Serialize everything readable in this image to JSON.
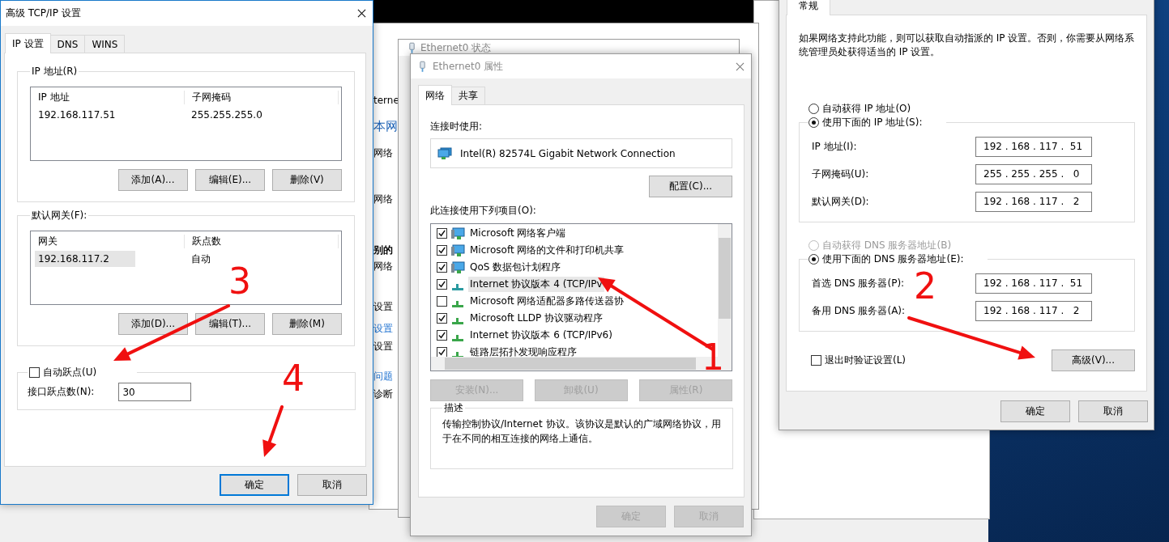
{
  "background_window": {
    "fragments": [
      {
        "text": "terne",
        "kind": "text"
      },
      {
        "text": "本网",
        "kind": "heading"
      },
      {
        "text": "网络",
        "kind": "text"
      },
      {
        "text": "网络",
        "kind": "text"
      },
      {
        "text": "别的",
        "kind": "bold"
      },
      {
        "text": "网络",
        "kind": "text"
      },
      {
        "text": "设置",
        "kind": "text"
      },
      {
        "text": "设置",
        "kind": "link"
      },
      {
        "text": "设置",
        "kind": "text"
      },
      {
        "text": "问题",
        "kind": "link"
      },
      {
        "text": "诊断",
        "kind": "text"
      }
    ]
  },
  "status_window": {
    "title": "Ethernet0 状态"
  },
  "tcpip_dialog": {
    "title": "高级 TCP/IP 设置",
    "tabs": [
      {
        "label": "IP 设置",
        "selected": true
      },
      {
        "label": "DNS",
        "selected": false
      },
      {
        "label": "WINS",
        "selected": false
      }
    ],
    "ip_group": {
      "legend": "IP 地址(R)",
      "columns": [
        "IP 地址",
        "子网掩码"
      ],
      "rows": [
        {
          "cells": [
            "192.168.117.51",
            "255.255.255.0"
          ],
          "selected": false
        }
      ],
      "buttons": [
        "添加(A)...",
        "编辑(E)...",
        "删除(V)"
      ]
    },
    "gateway_group": {
      "legend": "默认网关(F):",
      "columns": [
        "网关",
        "跃点数"
      ],
      "rows": [
        {
          "cells": [
            "192.168.117.2",
            "自动"
          ],
          "selected": true
        }
      ],
      "buttons": [
        "添加(D)...",
        "编辑(T)...",
        "删除(M)"
      ]
    },
    "metric_group": {
      "checkbox": {
        "label": "自动跃点(U)",
        "checked": false
      },
      "label": "接口跃点数(N):",
      "value": "30"
    },
    "buttons": [
      {
        "label": "确定",
        "default": true
      },
      {
        "label": "取消",
        "default": false
      }
    ]
  },
  "properties_dialog": {
    "title": "Ethernet0 属性",
    "tabs": [
      {
        "label": "网络",
        "selected": true
      },
      {
        "label": "共享",
        "selected": false
      }
    ],
    "connect_label": "连接时使用:",
    "adapter": "Intel(R) 82574L Gigabit Network Connection",
    "configure_button": "配置(C)...",
    "items_label": "此连接使用下列项目(O):",
    "items": [
      {
        "label": "Microsoft 网络客户端",
        "checked": true,
        "selected": false,
        "kind": "service"
      },
      {
        "label": "Microsoft 网络的文件和打印机共享",
        "checked": true,
        "selected": false,
        "kind": "service"
      },
      {
        "label": "QoS 数据包计划程序",
        "checked": true,
        "selected": false,
        "kind": "service"
      },
      {
        "label": "Internet 协议版本 4 (TCP/IPv",
        "checked": true,
        "selected": true,
        "kind": "protocol"
      },
      {
        "label": "Microsoft 网络适配器多路传送器协",
        "checked": false,
        "selected": false,
        "kind": "protocol"
      },
      {
        "label": "Microsoft LLDP 协议驱动程序",
        "checked": true,
        "selected": false,
        "kind": "protocol"
      },
      {
        "label": "Internet 协议版本 6 (TCP/IPv6)",
        "checked": true,
        "selected": false,
        "kind": "protocol"
      },
      {
        "label": "链路层拓扑发现响应程序",
        "checked": true,
        "selected": false,
        "kind": "protocol"
      }
    ],
    "item_buttons": [
      {
        "label": "安装(N)...",
        "disabled": true
      },
      {
        "label": "卸载(U)",
        "disabled": true
      },
      {
        "label": "属性(R)",
        "disabled": true
      }
    ],
    "description_legend": "描述",
    "description": "传输控制协议/Internet 协议。该协议是默认的广域网络协议，用于在不同的相互连接的网络上通信。",
    "buttons": [
      {
        "label": "确定",
        "disabled": true
      },
      {
        "label": "取消",
        "disabled": true
      }
    ]
  },
  "ipv4_dialog": {
    "tab": {
      "label": "常规",
      "selected": true
    },
    "intro": "如果网络支持此功能，则可以获取自动指派的 IP 设置。否则，你需要从网络系统管理员处获得适当的 IP 设置。",
    "ip_options": [
      {
        "label": "自动获得 IP 地址(O)",
        "selected": false,
        "disabled": false
      },
      {
        "label": "使用下面的 IP 地址(S):",
        "selected": true,
        "disabled": false
      }
    ],
    "ip_fields": [
      {
        "label": "IP 地址(I):",
        "value": "192 . 168 . 117 .  51"
      },
      {
        "label": "子网掩码(U):",
        "value": "255 . 255 . 255 .   0"
      },
      {
        "label": "默认网关(D):",
        "value": "192 . 168 . 117 .   2"
      }
    ],
    "dns_options": [
      {
        "label": "自动获得 DNS 服务器地址(B)",
        "selected": false,
        "disabled": true
      },
      {
        "label": "使用下面的 DNS 服务器地址(E):",
        "selected": true,
        "disabled": false
      }
    ],
    "dns_fields": [
      {
        "label": "首选 DNS 服务器(P):",
        "value": "192 . 168 . 117 .  51"
      },
      {
        "label": "备用 DNS 服务器(A):",
        "value": "192 . 168 . 117 .   2"
      }
    ],
    "validate_checkbox": {
      "label": "退出时验证设置(L)",
      "checked": false
    },
    "advanced_button": "高级(V)...",
    "buttons": [
      {
        "label": "确定",
        "default": false
      },
      {
        "label": "取消",
        "default": false
      }
    ]
  },
  "annotations": [
    {
      "text": "1"
    },
    {
      "text": "2"
    },
    {
      "text": "3"
    },
    {
      "text": "4"
    }
  ]
}
